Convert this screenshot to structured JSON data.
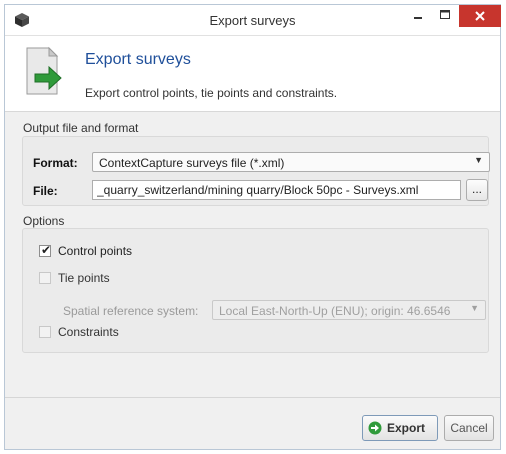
{
  "window": {
    "title": "Export surveys"
  },
  "header": {
    "title": "Export surveys",
    "subtitle": "Export control points, tie points and constraints."
  },
  "output_group": {
    "title": "Output file and format",
    "format_label": "Format:",
    "format_value": "ContextCapture surveys file (*.xml)",
    "file_label": "File:",
    "file_value": "_quarry_switzerland/mining quarry/Block 50pc - Surveys.xml",
    "browse_label": "..."
  },
  "options_group": {
    "title": "Options",
    "control_points": {
      "label": "Control points",
      "checked": true,
      "enabled": true
    },
    "tie_points": {
      "label": "Tie points",
      "checked": false,
      "enabled": false
    },
    "srs_label": "Spatial reference system:",
    "srs_value": "Local East-North-Up (ENU); origin: 46.6546",
    "constraints": {
      "label": "Constraints",
      "checked": false,
      "enabled": false
    }
  },
  "buttons": {
    "export_label": "Export",
    "cancel_label": "Cancel"
  },
  "colors": {
    "accent_title": "#1f4f9a",
    "close_button": "#c7352d",
    "export_icon": "#2f9a3a"
  },
  "icons": {
    "app": "cube-icon",
    "header": "document-export-icon",
    "export": "arrow-circle-icon",
    "dropdown": "chevron-down-icon"
  }
}
